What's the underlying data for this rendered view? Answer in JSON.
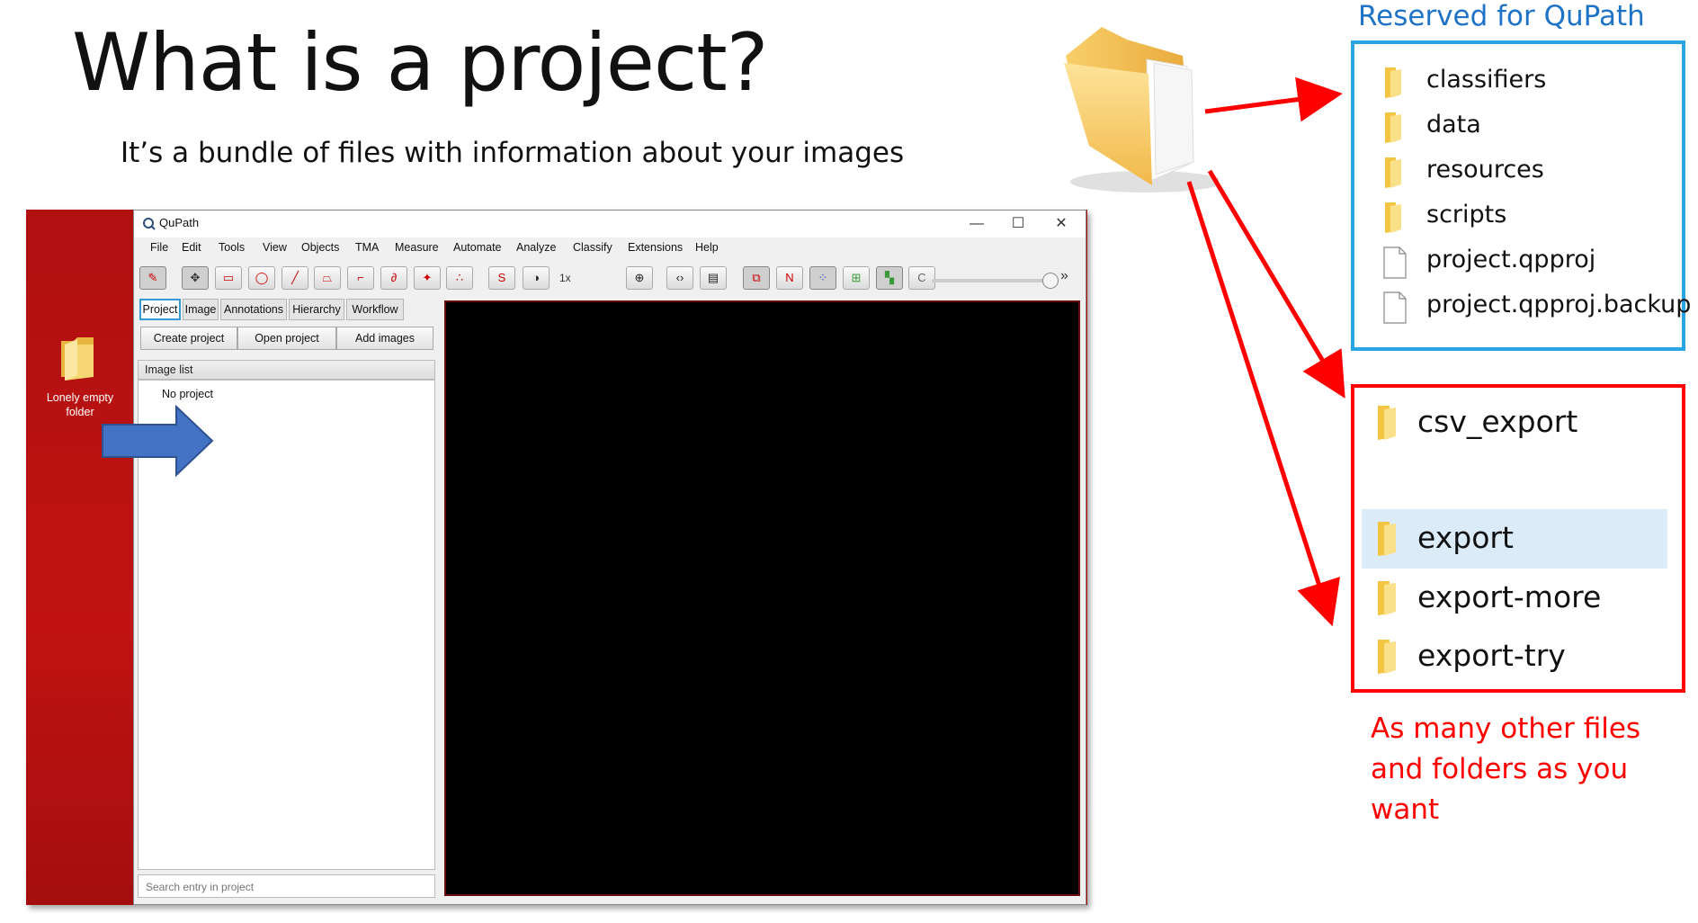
{
  "slide": {
    "title": "What is a project?",
    "subtitle": "It’s a bundle of files with information about your images"
  },
  "desktop": {
    "folder_label": "Lonely empty folder"
  },
  "qupath": {
    "window_title": "QuPath",
    "window_controls": {
      "minimize": "—",
      "maximize": "☐",
      "close": "✕"
    },
    "menu": [
      "File",
      "Edit",
      "Tools",
      "View",
      "Objects",
      "TMA",
      "Measure",
      "Automate",
      "Analyze",
      "Classify",
      "Extensions",
      "Help"
    ],
    "toolbar": {
      "zoom_label": "1x",
      "more": "»",
      "icons": [
        "ruler-icon",
        "move-icon",
        "rectangle-icon",
        "ellipse-icon",
        "line-icon",
        "polygon-icon",
        "polyline-icon",
        "brush-icon",
        "wand-icon",
        "points-icon",
        "selection-mode-icon",
        "contrast-icon",
        "zoom-to-fit-icon",
        "script-icon",
        "log-icon",
        "show-annotations-icon",
        "show-tma-grid-icon",
        "show-detections-icon",
        "fill-detections-icon",
        "show-pixel-classification-icon",
        "show-cells-icon"
      ],
      "accent_color": "#c00000"
    },
    "tabs": [
      "Project",
      "Image",
      "Annotations",
      "Hierarchy",
      "Workflow"
    ],
    "active_tab": "Project",
    "project_buttons": {
      "create": "Create project",
      "open": "Open project",
      "add": "Add images"
    },
    "image_list_header": "Image list",
    "image_list_empty": "No project",
    "search_placeholder": "Search entry in project"
  },
  "reserved": {
    "label": "Reserved for QuPath",
    "border_color": "#2aa5e4",
    "items": [
      {
        "name": "classifiers",
        "type": "folder"
      },
      {
        "name": "data",
        "type": "folder"
      },
      {
        "name": "resources",
        "type": "folder"
      },
      {
        "name": "scripts",
        "type": "folder"
      },
      {
        "name": "project.qpproj",
        "type": "file"
      },
      {
        "name": "project.qpproj.backup",
        "type": "file"
      }
    ]
  },
  "user_files": {
    "border_color": "#ff0000",
    "items": [
      {
        "name": "csv_export",
        "type": "folder"
      },
      {
        "name": "export",
        "type": "folder",
        "highlighted": true
      },
      {
        "name": "export-more",
        "type": "folder"
      },
      {
        "name": "export-try",
        "type": "folder"
      }
    ],
    "note": "As many other files and folders as you want"
  }
}
